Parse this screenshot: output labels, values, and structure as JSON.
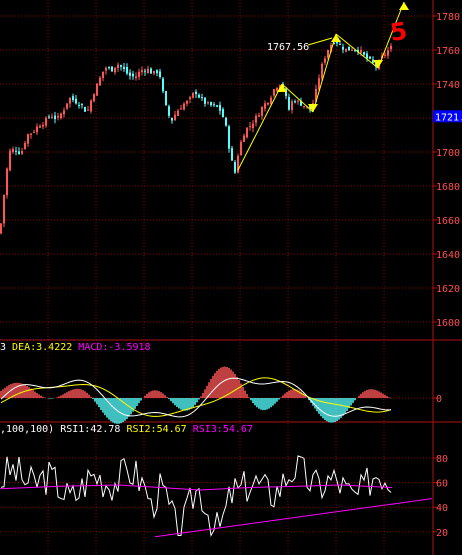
{
  "chart_data": [
    {
      "type": "candlestick",
      "panel": "price",
      "ylim": [
        1590,
        1785
      ],
      "y_ticks": [
        1600,
        1620,
        1640,
        1660,
        1680,
        1700,
        1720,
        1740,
        1760,
        1780
      ],
      "current_price_tag": "1721.",
      "annotations": {
        "price_label": "1767.56",
        "wave_label": "5"
      },
      "colors": {
        "up": "#ff5555",
        "down": "#55ffff",
        "grid": "#8b0000",
        "axis": "#b01010",
        "annotation": "#ffff00",
        "wave_label": "#ff0000"
      },
      "close_path": [
        [
          0,
          1652
        ],
        [
          3,
          1670
        ],
        [
          9,
          1700
        ],
        [
          15,
          1702
        ],
        [
          21,
          1699
        ],
        [
          27,
          1710
        ],
        [
          33,
          1712
        ],
        [
          39,
          1716
        ],
        [
          45,
          1718
        ],
        [
          51,
          1722
        ],
        [
          57,
          1719
        ],
        [
          63,
          1724
        ],
        [
          69,
          1732
        ],
        [
          75,
          1730
        ],
        [
          81,
          1728
        ],
        [
          87,
          1723
        ],
        [
          93,
          1734
        ],
        [
          99,
          1742
        ],
        [
          105,
          1750
        ],
        [
          111,
          1748
        ],
        [
          117,
          1752
        ],
        [
          123,
          1749
        ],
        [
          129,
          1745
        ],
        [
          135,
          1744
        ],
        [
          141,
          1748
        ],
        [
          147,
          1749
        ],
        [
          153,
          1746
        ],
        [
          159,
          1748
        ],
        [
          165,
          1728
        ],
        [
          171,
          1718
        ],
        [
          177,
          1724
        ],
        [
          183,
          1728
        ],
        [
          189,
          1730
        ],
        [
          195,
          1736
        ],
        [
          201,
          1731
        ],
        [
          207,
          1728
        ],
        [
          213,
          1727
        ],
        [
          219,
          1726
        ],
        [
          225,
          1718
        ],
        [
          231,
          1696
        ],
        [
          235,
          1688
        ],
        [
          239,
          1702
        ],
        [
          245,
          1713
        ],
        [
          251,
          1716
        ],
        [
          257,
          1721
        ],
        [
          263,
          1727
        ],
        [
          269,
          1731
        ],
        [
          275,
          1738
        ],
        [
          281,
          1741
        ],
        [
          285,
          1734
        ],
        [
          289,
          1725
        ],
        [
          293,
          1731
        ],
        [
          299,
          1729
        ],
        [
          305,
          1727
        ],
        [
          311,
          1725
        ],
        [
          315,
          1733
        ],
        [
          319,
          1744
        ],
        [
          323,
          1753
        ],
        [
          329,
          1762
        ],
        [
          335,
          1766
        ],
        [
          341,
          1762
        ],
        [
          347,
          1760
        ],
        [
          353,
          1761
        ],
        [
          359,
          1760
        ],
        [
          365,
          1756
        ],
        [
          371,
          1753
        ],
        [
          377,
          1750
        ],
        [
          381,
          1755
        ],
        [
          387,
          1759
        ],
        [
          392,
          1762
        ]
      ]
    },
    {
      "type": "bar+line",
      "panel": "MACD",
      "header": {
        "prefix": "3 ",
        "dea": "DEA:3.4222",
        "macd": "MACD:-3.5918"
      },
      "ylim": [
        -8,
        8
      ],
      "y_ticks": [
        0
      ],
      "series_colors": {
        "dif": "#ffffff",
        "dea": "#ffff00",
        "bar_up": "#ff5555",
        "bar_down": "#55ffff"
      }
    },
    {
      "type": "line",
      "panel": "RSI",
      "header": {
        "prefix": ",100,100) ",
        "rsi1": "RSI1:42.78",
        "rsi2": "RSI2:54.67",
        "rsi3": "RSI3:54.67"
      },
      "ylim": [
        15,
        92
      ],
      "y_ticks": [
        20,
        40,
        60,
        80
      ],
      "series_colors": {
        "rsi1": "#ffffff",
        "rsi3": "#ff00ff"
      },
      "series": [
        {
          "name": "RSI3",
          "values": [
            [
              0,
              55
            ],
            [
              60,
              57
            ],
            [
              120,
              58
            ],
            [
              160,
              56
            ],
            [
              200,
              54
            ],
            [
              250,
              56
            ],
            [
              300,
              57
            ],
            [
              340,
              58
            ],
            [
              392,
              56
            ]
          ]
        }
      ],
      "trendline": {
        "color": "#ff00ff",
        "from": [
          155,
          16
        ],
        "to": [
          432,
          47
        ]
      }
    }
  ]
}
